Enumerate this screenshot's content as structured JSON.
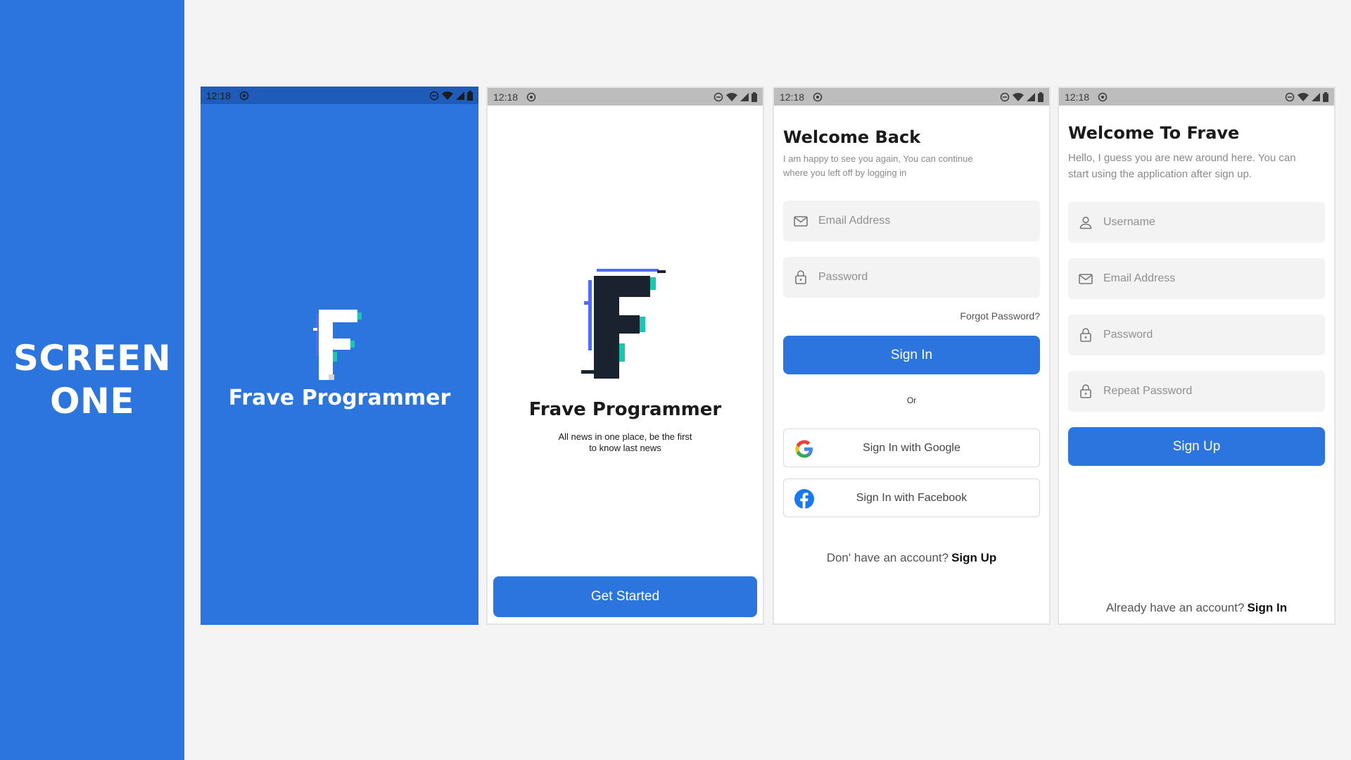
{
  "side_panel": {
    "title": "SCREEN\nONE"
  },
  "status": {
    "time": "12:18"
  },
  "splash": {
    "title": "Frave Programmer"
  },
  "get_started": {
    "title": "Frave Programmer",
    "subtitle": "All news in one place, be the first to know last news",
    "button": "Get Started"
  },
  "signin": {
    "title": "Welcome Back",
    "subtitle": "I am happy to see you again, You can continue where you left off by logging in",
    "email_placeholder": "Email Address",
    "password_placeholder": "Password",
    "forgot": "Forgot Password?",
    "button": "Sign In",
    "or": "Or",
    "google": "Sign In with Google",
    "facebook": "Sign In with Facebook",
    "no_account": "Don' have an account?",
    "signup_link": "Sign Up"
  },
  "signup": {
    "title": "Welcome To Frave",
    "subtitle": "Hello, I guess you are new around here. You can start using the application after sign up.",
    "username_placeholder": "Username",
    "email_placeholder": "Email Address",
    "password_placeholder": "Password",
    "repeat_placeholder": "Repeat Password",
    "button": "Sign Up",
    "have_account": "Already have an account?",
    "signin_link": "Sign In"
  },
  "colors": {
    "brand_blue": "#2d75de",
    "logo_dark": "#1a2230",
    "logo_accent_teal": "#18c8b0",
    "logo_accent_blue": "#4f6bff"
  }
}
